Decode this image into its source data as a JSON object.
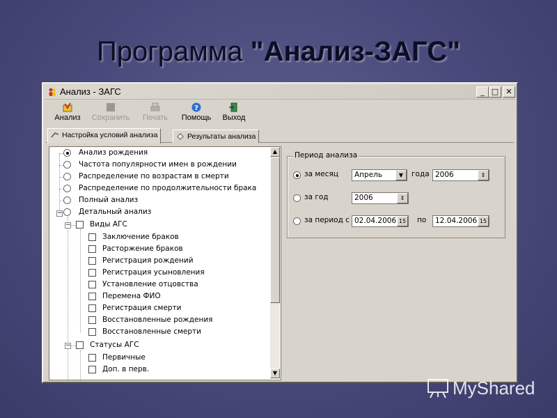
{
  "slide": {
    "title_part1": "Программа ",
    "title_part2": "\"Анализ-ЗАГС\""
  },
  "window": {
    "title": "Анализ - ЗАГС",
    "controls": {
      "minimize": "_",
      "maximize": "□",
      "close": "✕"
    }
  },
  "toolbar": {
    "analysis": "Анализ",
    "save": "Сохранить",
    "print": "Печать",
    "help": "Помощь",
    "exit": "Выход"
  },
  "tabs": {
    "settings": "Настройка условий анализа",
    "results": "Результаты анализа"
  },
  "tree": {
    "radios": [
      {
        "label": "Анализ рождения",
        "selected": true
      },
      {
        "label": "Частота популярности имен в рождении",
        "selected": false
      },
      {
        "label": "Распределение по возрастам в смерти",
        "selected": false
      },
      {
        "label": "Распределение по продолжительности брака",
        "selected": false
      },
      {
        "label": "Полный анализ",
        "selected": false
      },
      {
        "label": "Детальный анализ",
        "selected": false
      }
    ],
    "group1": {
      "label": "Виды АГС",
      "items": [
        "Заключение браков",
        "Расторжение браков",
        "Регистрация рождений",
        "Регистрация усыновления",
        "Установление отцовства",
        "Перемена ФИО",
        "Регистрация смерти",
        "Восстановленные рождения",
        "Восстановленные смерти"
      ]
    },
    "group2": {
      "label": "Статусы АГС",
      "items": [
        "Первичные",
        "Доп. в перв."
      ]
    }
  },
  "period": {
    "legend": "Период анализа",
    "by_month_label": "за месяц",
    "month_value": "Апрель",
    "year_label": "года",
    "year_value": "2006",
    "by_year_label": "за год",
    "year2_value": "2006",
    "by_period_label": "за период с",
    "from_date": "02.04.2006",
    "to_label": "по",
    "to_date": "12.04.2006",
    "selected": "month"
  },
  "watermark": {
    "text": "MyShared"
  }
}
